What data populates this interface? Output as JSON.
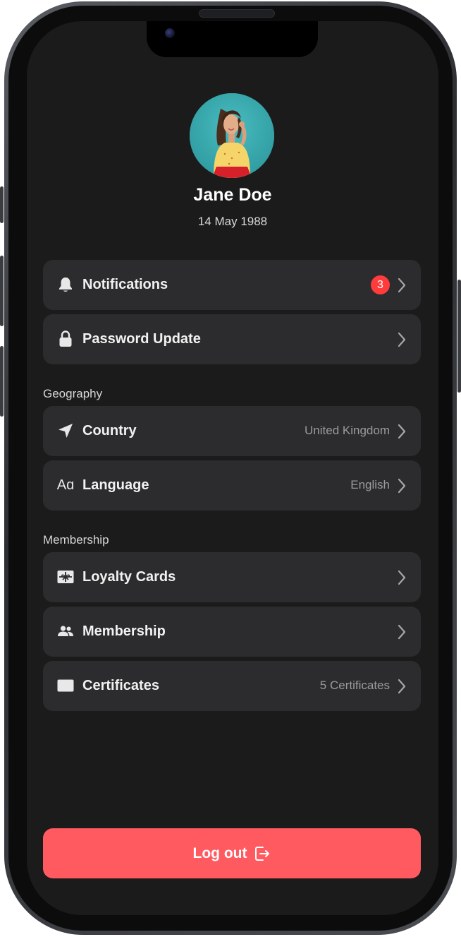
{
  "profile": {
    "name": "Jane Doe",
    "dob": "14 May 1988",
    "avatar_icon": "user-photo"
  },
  "account": {
    "notifications": {
      "label": "Notifications",
      "badge": "3",
      "icon": "bell-icon"
    },
    "password": {
      "label": "Password Update",
      "icon": "lock-icon"
    }
  },
  "geography": {
    "title": "Geography",
    "country": {
      "label": "Country",
      "value": "United Kingdom",
      "icon": "location-arrow-icon"
    },
    "language": {
      "label": "Language",
      "value": "English",
      "icon": "text-size-icon",
      "glyph": "Aɑ"
    }
  },
  "membership": {
    "title": "Membership",
    "loyalty": {
      "label": "Loyalty Cards",
      "icon": "gift-card-icon"
    },
    "membership": {
      "label": "Membership",
      "icon": "people-icon"
    },
    "certificates": {
      "label": "Certificates",
      "value": "5 Certificates",
      "icon": "certificate-card-icon"
    }
  },
  "logout": {
    "label": "Log out",
    "icon": "logout-icon"
  },
  "colors": {
    "background": "#1b1b1c",
    "row": "#2c2c2e",
    "accent": "#ff5a5f",
    "badge": "#ff3b3b"
  }
}
